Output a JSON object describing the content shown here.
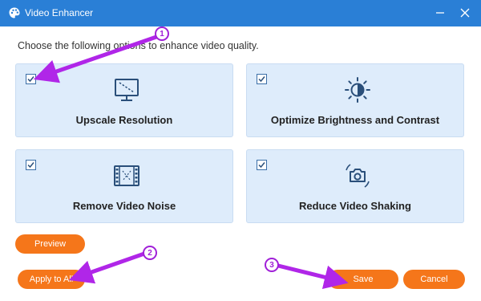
{
  "window": {
    "title": "Video Enhancer",
    "app_icon": "palette-icon",
    "minimize_icon": "minimize-icon",
    "close_icon": "close-icon",
    "title_bar_color": "#2a7fd6"
  },
  "instruction": "Choose the following options to enhance video quality.",
  "options": [
    {
      "label": "Upscale Resolution",
      "checked": true,
      "icon": "monitor-upscale-icon"
    },
    {
      "label": "Optimize Brightness and Contrast",
      "checked": true,
      "icon": "brightness-icon"
    },
    {
      "label": "Remove Video Noise",
      "checked": true,
      "icon": "film-strip-icon"
    },
    {
      "label": "Reduce Video Shaking",
      "checked": true,
      "icon": "stabilize-camera-icon"
    }
  ],
  "buttons": {
    "preview": "Preview",
    "apply_to_all": "Apply to All",
    "save": "Save",
    "cancel": "Cancel"
  },
  "annotations": {
    "step1": "1",
    "step2": "2",
    "step3": "3",
    "color": "#a020d8"
  },
  "colors": {
    "accent": "#f5761a",
    "card_bg": "#deecfb",
    "icon": "#2a4f7a"
  }
}
